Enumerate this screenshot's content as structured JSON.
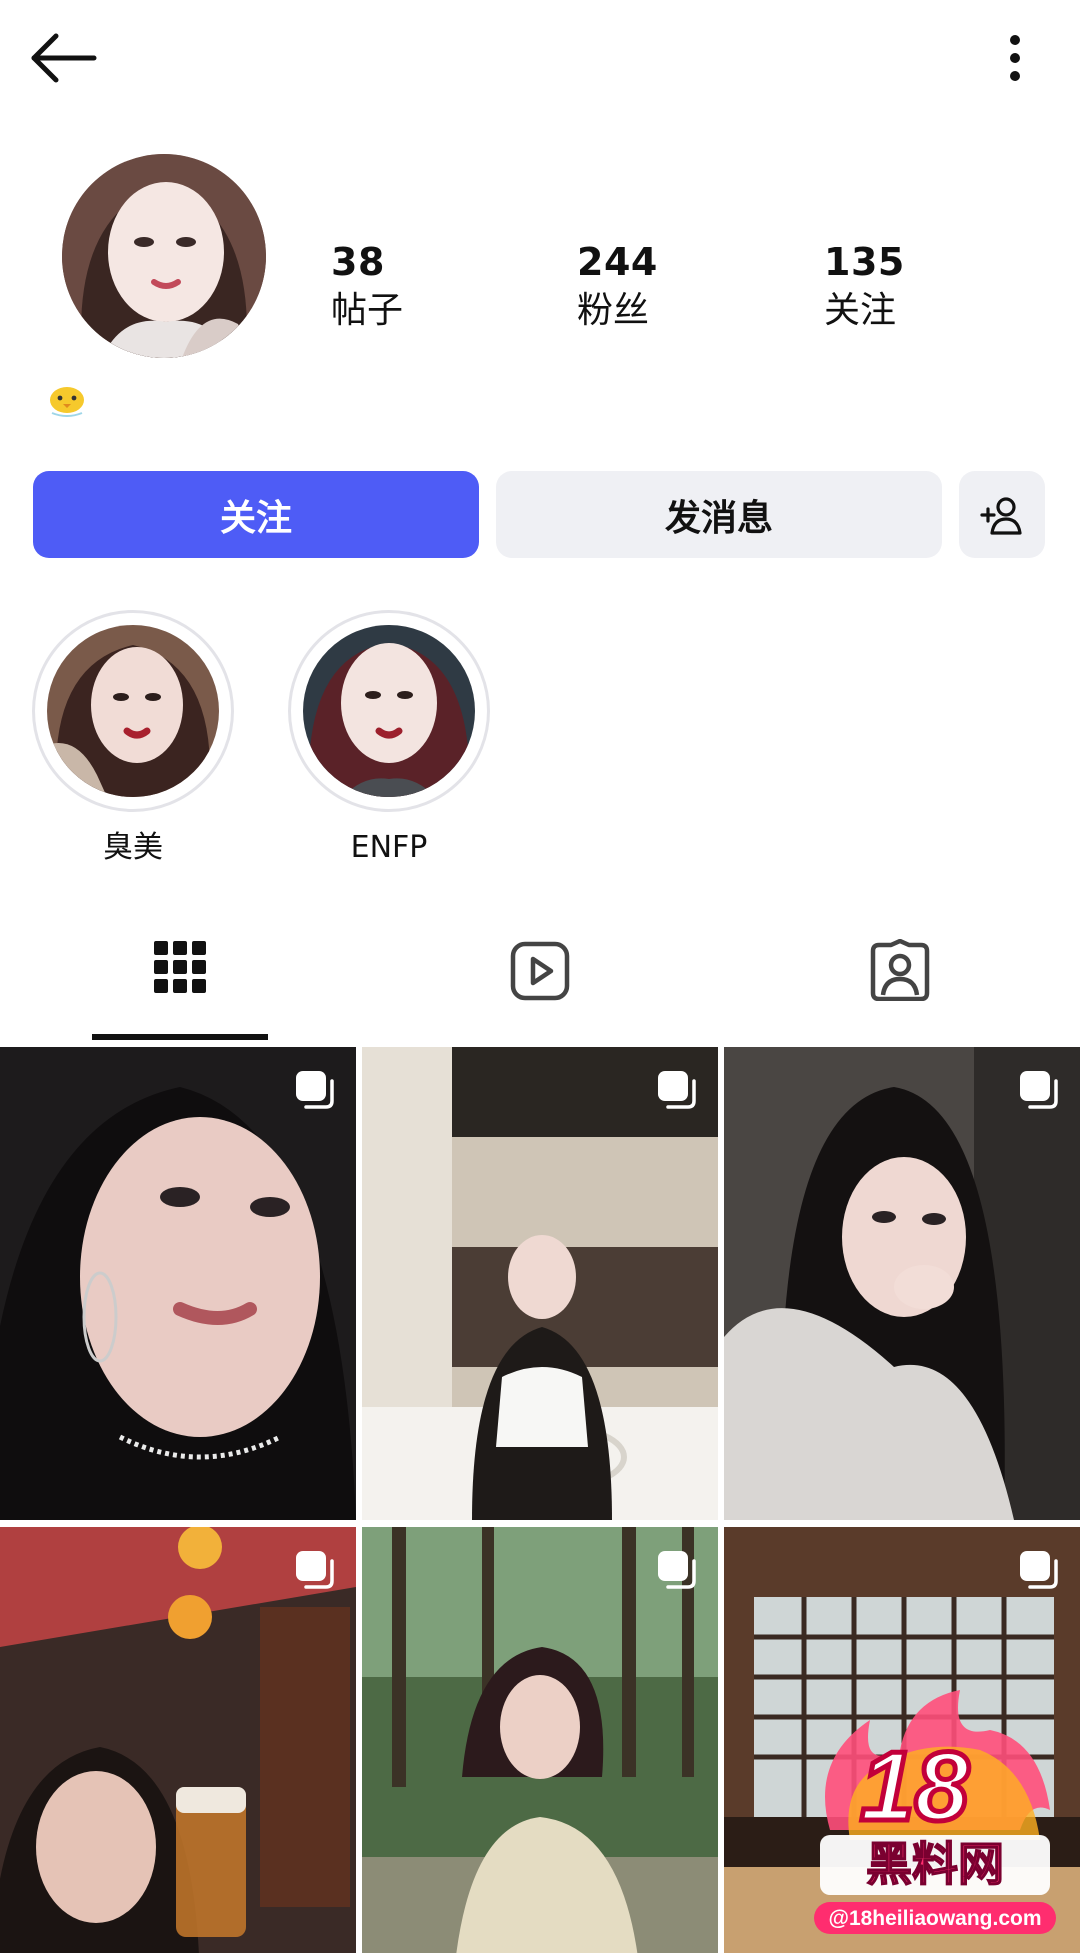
{
  "header": {
    "back_icon": "arrow-left-icon",
    "more_icon": "more-vertical-icon"
  },
  "profile": {
    "stats": [
      {
        "value": "38",
        "label": "帖子"
      },
      {
        "value": "244",
        "label": "粉丝"
      },
      {
        "value": "135",
        "label": "关注"
      }
    ],
    "bio_icon": "chick-emoji-icon"
  },
  "actions": {
    "follow_label": "关注",
    "message_label": "发消息",
    "add_friend_icon": "add-person-icon",
    "accent_color": "#4e5cf6"
  },
  "highlights": [
    {
      "label": "臭美"
    },
    {
      "label": "ENFP"
    }
  ],
  "tabs": [
    {
      "name": "posts",
      "icon": "grid-icon",
      "selected": true
    },
    {
      "name": "reels",
      "icon": "play-square-icon",
      "selected": false
    },
    {
      "name": "tagged",
      "icon": "tagged-person-icon",
      "selected": false
    }
  ],
  "watermark": {
    "big": "18",
    "name": "黑料网",
    "url": "@18heiliaowang.com"
  }
}
